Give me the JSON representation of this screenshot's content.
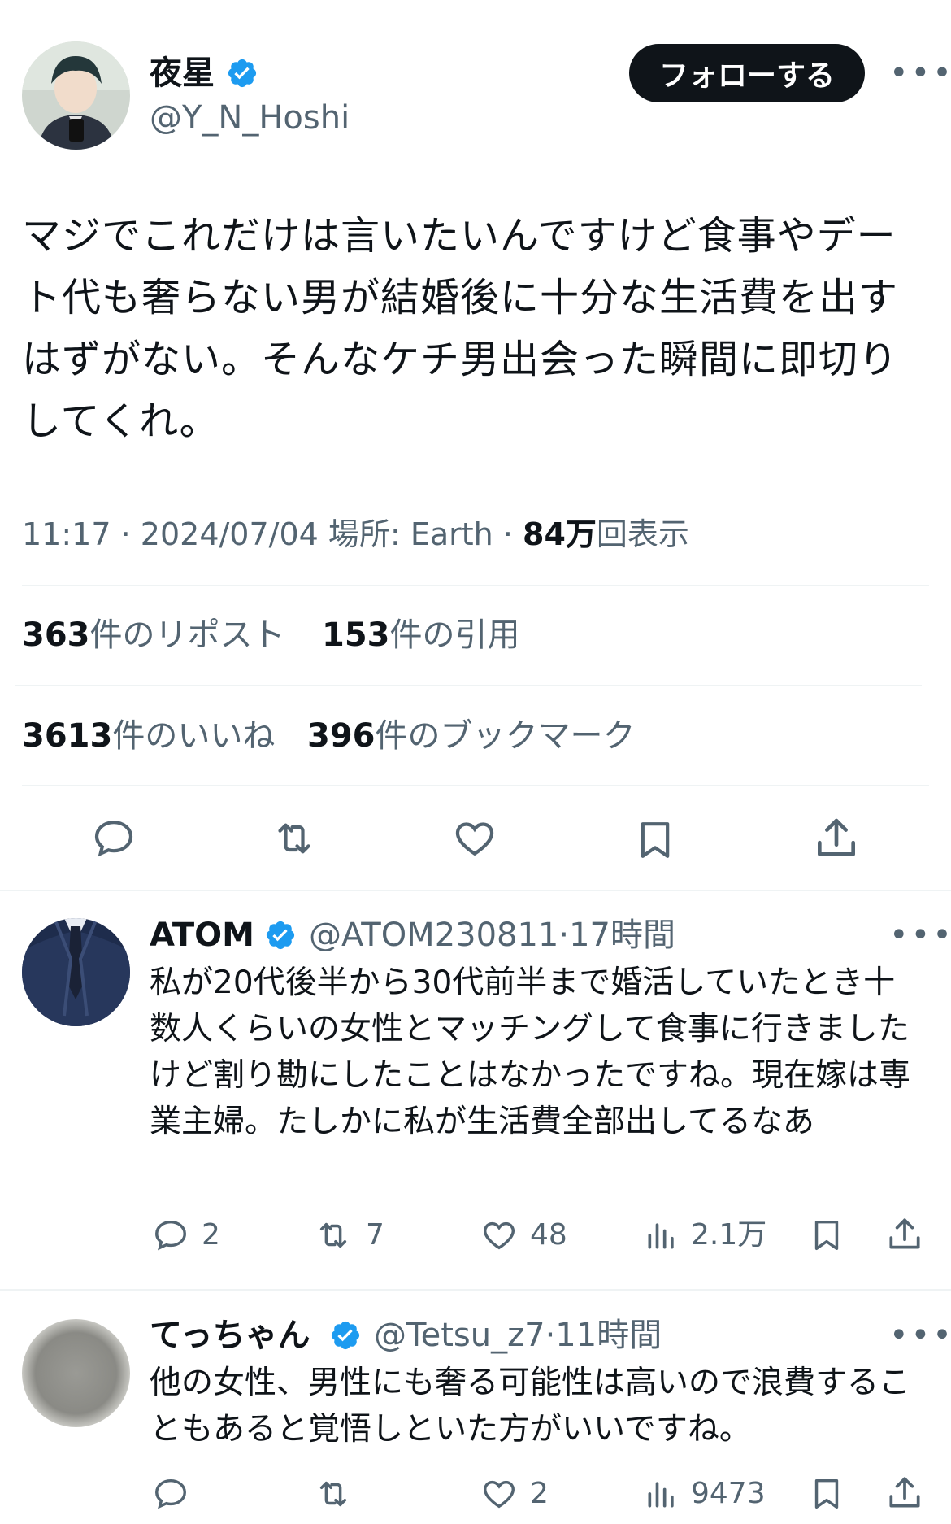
{
  "tweet": {
    "author_name": "夜星",
    "author_handle": "@Y_N_Hoshi",
    "follow_label": "フォローする",
    "more_label": "•••",
    "text": "マジでこれだけは言いたいんですけど食事やデート代も奢らない男が結婚後に十分な生活費を出すはずがない。そんなケチ男出会った瞬間に即切りしてくれ。",
    "time": "11:17",
    "date": "2024/07/04",
    "place_label": "場所:",
    "place": "Earth",
    "views_count": "84万",
    "views_label": "回表示",
    "sep": "·",
    "reposts_count": "363",
    "reposts_label": "件のリポスト",
    "quotes_count": "153",
    "quotes_label": "件の引用",
    "likes_count": "3613",
    "likes_label": "件のいいね",
    "bookmarks_count": "396",
    "bookmarks_label": "件のブックマーク"
  },
  "replies": [
    {
      "name": "ATOM",
      "handle": "@ATOM230811",
      "time": "17時間",
      "sep": "·",
      "more_label": "•••",
      "text": "私が20代後半から30代前半まで婚活していたとき十数人くらいの女性とマッチングして食事に行きましたけど割り勘にしたことはなかったですね。現在嫁は専業主婦。たしかに私が生活費全部出してるなあ",
      "replies_count": "2",
      "reposts_count": "7",
      "likes_count": "48",
      "views_count": "2.1万"
    },
    {
      "name": "てっちゃん",
      "handle": "@Tetsu_z7",
      "time": "11時間",
      "sep": "·",
      "more_label": "•••",
      "text": "他の女性、男性にも奢る可能性は高いので浪費することもあると覚悟しといた方がいいですね。",
      "replies_count": "",
      "reposts_count": "",
      "likes_count": "2",
      "views_count": "9473"
    }
  ],
  "colors": {
    "text_primary": "#0f1419",
    "text_secondary": "#536471",
    "verified_blue": "#1d9bf0",
    "divider": "#eff3f4",
    "follow_bg": "#0f1419"
  }
}
